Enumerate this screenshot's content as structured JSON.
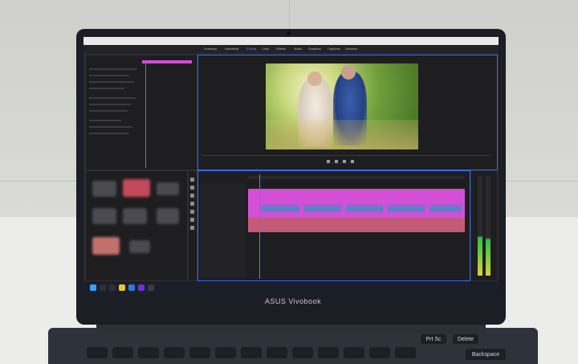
{
  "laptop": {
    "brand": "ASUS Vivobook"
  },
  "premiere": {
    "workspace_tabs": [
      "Learning",
      "Assembly",
      "Editing",
      "Color",
      "Effects",
      "Audio",
      "Graphics",
      "Captions",
      "Libraries"
    ]
  },
  "keyboard": {
    "labeled_keys": [
      "Prt Sc",
      "Delete",
      "Backspace"
    ]
  },
  "colors": {
    "accent_selection": "#2f6bff",
    "timeline_clip": "#d24fd6",
    "timeline_clip_secondary": "#5f7fc9",
    "audio_clip": "#c45a7a"
  }
}
